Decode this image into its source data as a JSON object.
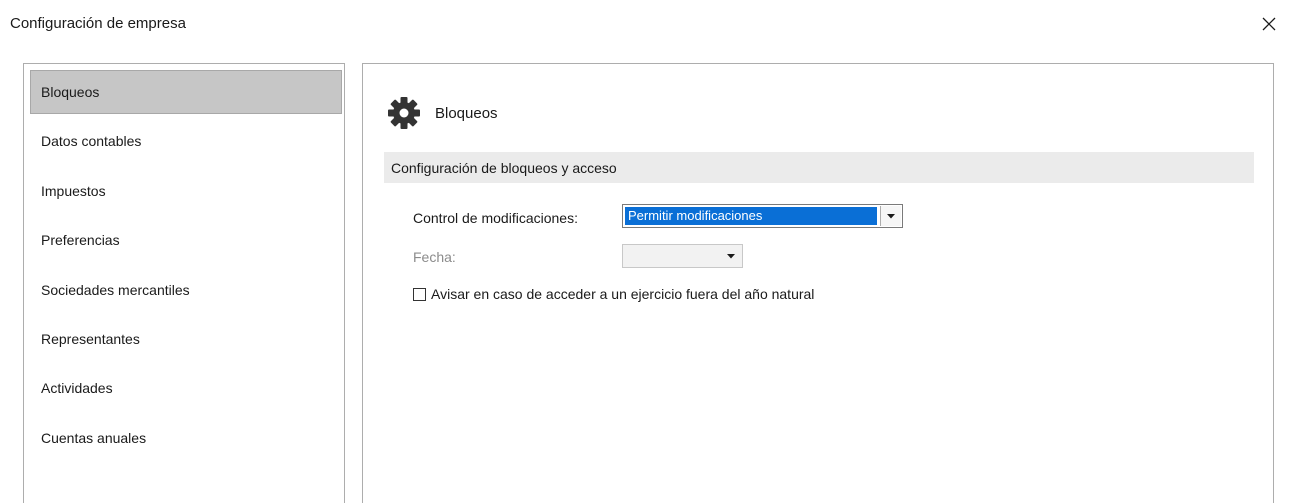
{
  "window": {
    "title": "Configuración de empresa",
    "close_icon": "close-icon"
  },
  "sidebar": {
    "items": [
      {
        "label": "Bloqueos",
        "selected": true
      },
      {
        "label": "Datos contables",
        "selected": false
      },
      {
        "label": "Impuestos",
        "selected": false
      },
      {
        "label": "Preferencias",
        "selected": false
      },
      {
        "label": "Sociedades mercantiles",
        "selected": false
      },
      {
        "label": "Representantes",
        "selected": false
      },
      {
        "label": "Actividades",
        "selected": false
      },
      {
        "label": "Cuentas anuales",
        "selected": false
      }
    ]
  },
  "panel": {
    "icon": "gear-icon",
    "title": "Bloqueos",
    "section_title": "Configuración de bloqueos y acceso",
    "control_label": "Control de modificaciones:",
    "control_value": "Permitir modificaciones",
    "fecha_label": "Fecha:",
    "fecha_value": "",
    "checkbox_label": "Avisar en caso de acceder a un ejercicio fuera del año natural",
    "checkbox_checked": false
  },
  "colors": {
    "selection_blue": "#0a6fd6",
    "sidebar_selected": "#c6c6c6",
    "section_bar": "#ebebeb"
  }
}
